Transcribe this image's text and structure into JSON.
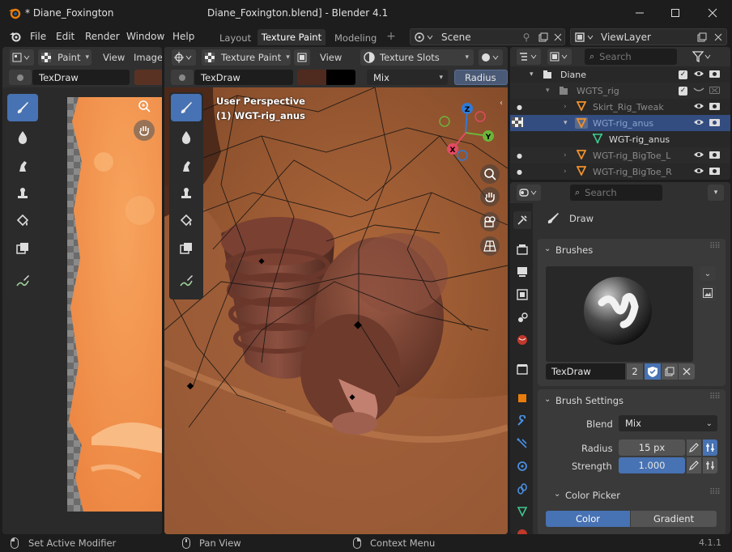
{
  "window": {
    "file_name": "* Diane_Foxington",
    "title": "Diane_Foxington.blend] - Blender 4.1"
  },
  "menu": {
    "items": [
      "File",
      "Edit",
      "Render",
      "Window",
      "Help"
    ]
  },
  "workspaces": {
    "tabs": [
      "Layout",
      "Texture Paint",
      "Modeling"
    ],
    "active": "Texture Paint"
  },
  "scene": {
    "label": "Scene"
  },
  "view_layer": {
    "label": "ViewLayer"
  },
  "image_editor": {
    "mode": "Paint",
    "menus": [
      "View",
      "Image"
    ],
    "brush_name": "TexDraw"
  },
  "viewport": {
    "mode": "Texture Paint",
    "view_menu": "View",
    "texture_slots": "Texture Slots",
    "brush_name": "TexDraw",
    "blend": "Mix",
    "radius_label": "Radius",
    "overlay_line1": "User Perspective",
    "overlay_line2": "(1) WGT-rig_anus",
    "gizmo": {
      "z": "Z",
      "y": "Y",
      "x": "X"
    }
  },
  "outliner": {
    "search_placeholder": "Search",
    "rows": [
      {
        "label": "Diane"
      },
      {
        "label": "WGTS_rig"
      },
      {
        "label": "Skirt_Rig_Tweak"
      },
      {
        "label": "WGT-rig_anus"
      },
      {
        "label": "WGT-rig_anus"
      },
      {
        "label": "WGT-rig_BigToe_L"
      },
      {
        "label": "WGT-rig_BigToe_R"
      }
    ]
  },
  "properties": {
    "search_placeholder": "Search",
    "tool_name": "Draw",
    "brushes_panel": "Brushes",
    "brush_name": "TexDraw",
    "brush_users": "2",
    "brush_settings_panel": "Brush Settings",
    "blend_label": "Blend",
    "blend_value": "Mix",
    "radius_label": "Radius",
    "radius_value": "15 px",
    "strength_label": "Strength",
    "strength_value": "1.000",
    "strength_fraction": 1.0,
    "color_picker_panel": "Color Picker",
    "color_tab": "Color",
    "gradient_tab": "Gradient"
  },
  "status_bar": {
    "left": "Set Active Modifier",
    "middle": "Pan View",
    "right": "Context Menu",
    "version": "4.1.1"
  },
  "colors": {
    "accent": "#4772b3",
    "selected_row": "#334d80",
    "skin": "#a5613a",
    "texture_orange": "#f08a45"
  }
}
